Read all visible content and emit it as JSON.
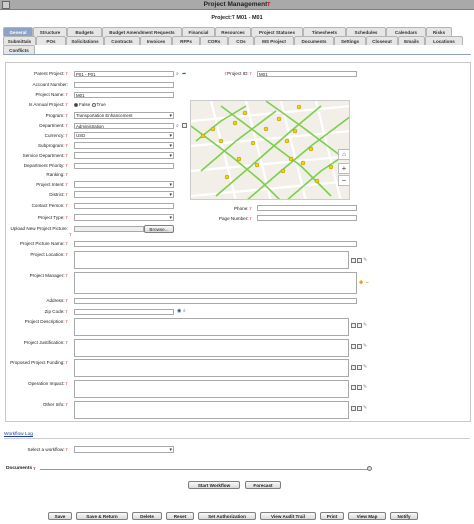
{
  "window": {
    "title": "Project Management",
    "title_mark": "T"
  },
  "project_line": {
    "label": "Project:",
    "value": "M01 - M01",
    "mark": "T"
  },
  "tabs_row1": [
    "General",
    "Structure",
    "Budgets",
    "Budget Amendment Requests",
    "Financial",
    "Resources",
    "Project Statuses",
    "Timesheets",
    "Schedules",
    "Calendars",
    "Risks"
  ],
  "tabs_row2": [
    "Submittals",
    "POs",
    "Solicitations",
    "Contracts",
    "Invoices",
    "RFPs",
    "CORs",
    "COs",
    "MS Project",
    "Documents",
    "Settings",
    "Closeout",
    "Emails",
    "Locations"
  ],
  "tabs_row3": [
    "Conflicts"
  ],
  "fields": {
    "parent_project": {
      "label": "Parent Project:",
      "value": "P01 - P01"
    },
    "project_id": {
      "label": "Project ID:",
      "value": "M01"
    },
    "account_number": {
      "label": "Account Number:"
    },
    "project_name": {
      "label": "Project Name:",
      "value": "M01"
    },
    "is_annual": {
      "label": "Is Annual Project:",
      "opt_false": "False",
      "opt_true": "True"
    },
    "program": {
      "label": "Program:",
      "value": "Transportation Enhancement"
    },
    "department": {
      "label": "Department:",
      "value": "Administration"
    },
    "currency": {
      "label": "Currency:",
      "value": "USD"
    },
    "subprogram": {
      "label": "Subprogram:"
    },
    "service_department": {
      "label": "Service Department:"
    },
    "department_priority": {
      "label": "Department Priority:"
    },
    "ranking": {
      "label": "Ranking:"
    },
    "project_intent": {
      "label": "Project Intent:"
    },
    "district": {
      "label": "District:"
    },
    "contact_person": {
      "label": "Contact Person:"
    },
    "phone": {
      "label": "Phone:"
    },
    "project_type": {
      "label": "Project Type:"
    },
    "page_number": {
      "label": "Page Number:"
    },
    "upload_picture": {
      "label": "Upload New Project Picture:",
      "button": "Browse..."
    },
    "picture_name": {
      "label": "Project Picture Name:"
    },
    "project_location": {
      "label": "Project Location:"
    },
    "project_manager": {
      "label": "Project Manager:"
    },
    "address": {
      "label": "Address:"
    },
    "zip_code": {
      "label": "Zip Code:"
    },
    "project_description": {
      "label": "Project Description:"
    },
    "project_justification": {
      "label": "Project Justification:"
    },
    "proposed_funding": {
      "label": "Proposed Project Funding:"
    },
    "operation_impact": {
      "label": "Operation Impact:"
    },
    "other_info": {
      "label": "Other Info:"
    }
  },
  "workflow": {
    "link": "Workflow Log",
    "select_label": "Select a workflow:",
    "documents": "Documents",
    "start": "Start Workflow",
    "forecast": "Forecast"
  },
  "footer": [
    "Save",
    "Save & Return",
    "Delete",
    "Reset",
    "Set Authorization",
    "View Audit Trail",
    "Print",
    "View Map",
    "Notify"
  ],
  "map": {
    "zoom_in": "+",
    "zoom_out": "−"
  },
  "icons": {
    "mark": "T",
    "search": "⌕",
    "arrow": "➦",
    "plus": "✚",
    "minus": "−"
  }
}
